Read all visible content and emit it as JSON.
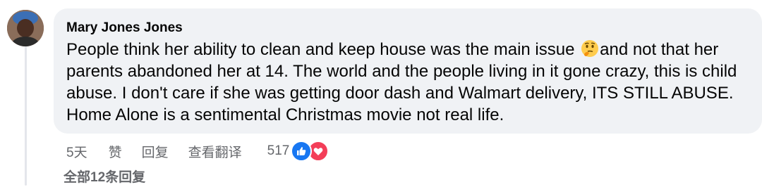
{
  "comment": {
    "author": "Mary Jones Jones",
    "text_before_emoji": "People think her ability to clean and keep house was the main issue ",
    "emoji": "thinking-face",
    "text_after_emoji": "and not that her parents abandoned her at 14. The world and the people living in it gone crazy, this is child abuse. I don't care if she was getting door dash and Walmart delivery, ITS STILL ABUSE. Home Alone is a sentimental Christmas movie not real life."
  },
  "actions": {
    "time": "5天",
    "like_label": "赞",
    "reply_label": "回复",
    "translate_label": "查看翻译"
  },
  "reactions": {
    "count": "517",
    "icons": [
      "like-icon",
      "love-icon"
    ]
  },
  "replies": {
    "label": "全部12条回复"
  },
  "colors": {
    "bubble": "#f0f2f5",
    "muted_text": "#65676b",
    "like_blue": "#1877f2",
    "love_red": "#f33e58"
  }
}
